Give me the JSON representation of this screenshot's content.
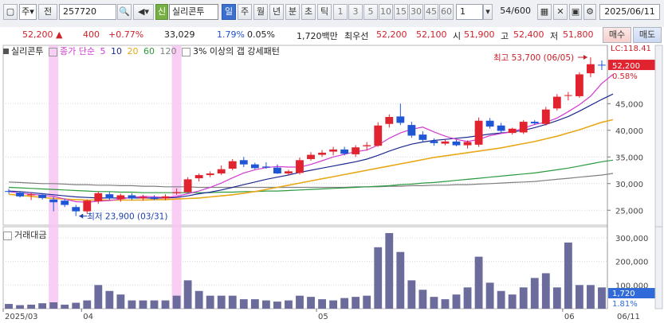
{
  "toolbar": {
    "market_sel": "주",
    "period_label": "전",
    "code": "257720",
    "badge_new": "신",
    "stock_name": "실리콘투",
    "tabs": [
      "일",
      "주",
      "월",
      "년",
      "분",
      "초",
      "틱"
    ],
    "active_tab": "일",
    "intervals": [
      "1",
      "3",
      "5",
      "10",
      "15",
      "30",
      "45",
      "60"
    ],
    "interval_input": "1",
    "count": "54",
    "count_total": "/600",
    "date": "2025/06/11"
  },
  "info": {
    "price": "52,200",
    "change": "400",
    "change_pct": "+0.77%",
    "volume": "33,029",
    "turnover_pct": "1.79%",
    "ratio": "0.05%",
    "trade_value": "1,720백만",
    "best_ask_label": "최우선",
    "best_ask": "52,200",
    "best_bid": "52,100",
    "open_label": "시",
    "open": "51,900",
    "high_label": "고",
    "high": "52,400",
    "low_label": "저",
    "low": "51,800",
    "buy_btn": "매수",
    "sell_btn": "매도"
  },
  "legend": {
    "name": "실리콘투",
    "ma_label": "종가 단순",
    "ma_periods": [
      "5",
      "10",
      "20",
      "60",
      "120"
    ],
    "gap_label": "3% 이상의 갭 강세패턴"
  },
  "price_axis": {
    "lc_label": "LC:118.41",
    "last_price": "52,200",
    "last_pct": "0.58%",
    "ticks": [
      "45,000",
      "40,000",
      "35,000",
      "30,000",
      "25,000"
    ]
  },
  "annotations": {
    "high": "최고 53,700 (06/05)",
    "low": "최저 23,900 (03/31)"
  },
  "volume_panel": {
    "label": "거래대금",
    "ticks": [
      "300,000",
      "200,000",
      "100,000"
    ],
    "last_value": "1,720",
    "last_pct": "1.81%"
  },
  "x_axis": {
    "labels": [
      "2025/03",
      "04",
      "05",
      "06",
      "06/11"
    ]
  },
  "colors": {
    "up": "#e0232e",
    "down": "#1f56d6",
    "ma5": "#d23ad1",
    "ma10": "#1d2a8f",
    "ma20": "#e8a817",
    "ma60": "#2a9a3e",
    "ma120": "#7f7f7f",
    "volume": "#6b6b9c",
    "highlight": "#f7c6f2"
  },
  "chart_data": {
    "type": "candlestick",
    "candles": [
      {
        "o": 28.6,
        "h": 29.0,
        "l": 28.1,
        "c": 28.5
      },
      {
        "o": 28.3,
        "h": 28.6,
        "l": 27.4,
        "c": 27.6
      },
      {
        "o": 27.8,
        "h": 28.3,
        "l": 26.9,
        "c": 28.0
      },
      {
        "o": 27.9,
        "h": 28.2,
        "l": 27.0,
        "c": 27.3
      },
      {
        "o": 27.0,
        "h": 27.5,
        "l": 24.8,
        "c": 26.5
      },
      {
        "o": 26.8,
        "h": 27.2,
        "l": 25.6,
        "c": 26.0
      },
      {
        "o": 25.6,
        "h": 26.0,
        "l": 23.9,
        "c": 24.8
      },
      {
        "o": 24.8,
        "h": 27.0,
        "l": 24.3,
        "c": 26.8
      },
      {
        "o": 26.7,
        "h": 28.5,
        "l": 26.2,
        "c": 28.2
      },
      {
        "o": 28.0,
        "h": 28.4,
        "l": 26.9,
        "c": 27.2
      },
      {
        "o": 27.1,
        "h": 28.1,
        "l": 26.6,
        "c": 27.8
      },
      {
        "o": 27.8,
        "h": 28.2,
        "l": 26.9,
        "c": 27.2
      },
      {
        "o": 27.2,
        "h": 27.9,
        "l": 26.8,
        "c": 27.5
      },
      {
        "o": 27.4,
        "h": 27.8,
        "l": 26.9,
        "c": 27.1
      },
      {
        "o": 27.2,
        "h": 28.0,
        "l": 26.9,
        "c": 27.6
      },
      {
        "o": 28.2,
        "h": 29.1,
        "l": 27.9,
        "c": 28.4
      },
      {
        "o": 28.4,
        "h": 31.2,
        "l": 28.3,
        "c": 30.8
      },
      {
        "o": 31.0,
        "h": 31.9,
        "l": 30.4,
        "c": 31.6
      },
      {
        "o": 31.6,
        "h": 32.3,
        "l": 31.2,
        "c": 31.9
      },
      {
        "o": 31.9,
        "h": 33.4,
        "l": 31.6,
        "c": 32.7
      },
      {
        "o": 32.8,
        "h": 34.6,
        "l": 32.5,
        "c": 34.2
      },
      {
        "o": 34.4,
        "h": 35.0,
        "l": 33.1,
        "c": 33.6
      },
      {
        "o": 33.6,
        "h": 33.9,
        "l": 32.7,
        "c": 32.9
      },
      {
        "o": 33.2,
        "h": 34.0,
        "l": 32.8,
        "c": 33.0
      },
      {
        "o": 33.0,
        "h": 33.6,
        "l": 31.8,
        "c": 31.9
      },
      {
        "o": 31.9,
        "h": 32.6,
        "l": 31.5,
        "c": 32.3
      },
      {
        "o": 32.0,
        "h": 34.9,
        "l": 31.7,
        "c": 34.4
      },
      {
        "o": 34.6,
        "h": 35.9,
        "l": 34.3,
        "c": 35.4
      },
      {
        "o": 35.4,
        "h": 36.3,
        "l": 35.0,
        "c": 35.8
      },
      {
        "o": 36.0,
        "h": 36.9,
        "l": 35.3,
        "c": 36.4
      },
      {
        "o": 36.4,
        "h": 36.9,
        "l": 35.3,
        "c": 35.6
      },
      {
        "o": 35.5,
        "h": 37.2,
        "l": 35.0,
        "c": 36.8
      },
      {
        "o": 37.0,
        "h": 37.8,
        "l": 36.2,
        "c": 37.2
      },
      {
        "o": 37.1,
        "h": 41.5,
        "l": 36.9,
        "c": 40.9
      },
      {
        "o": 41.2,
        "h": 43.0,
        "l": 40.5,
        "c": 42.5
      },
      {
        "o": 42.6,
        "h": 45.0,
        "l": 41.0,
        "c": 41.4
      },
      {
        "o": 41.0,
        "h": 41.6,
        "l": 38.6,
        "c": 39.0
      },
      {
        "o": 39.2,
        "h": 39.8,
        "l": 37.7,
        "c": 38.2
      },
      {
        "o": 38.0,
        "h": 38.5,
        "l": 37.1,
        "c": 37.6
      },
      {
        "o": 37.5,
        "h": 38.3,
        "l": 37.2,
        "c": 37.9
      },
      {
        "o": 37.9,
        "h": 38.2,
        "l": 37.0,
        "c": 37.2
      },
      {
        "o": 37.2,
        "h": 38.1,
        "l": 36.6,
        "c": 37.8
      },
      {
        "o": 37.3,
        "h": 42.4,
        "l": 36.9,
        "c": 41.8
      },
      {
        "o": 41.8,
        "h": 42.3,
        "l": 40.3,
        "c": 40.7
      },
      {
        "o": 40.9,
        "h": 41.4,
        "l": 39.6,
        "c": 39.9
      },
      {
        "o": 39.5,
        "h": 40.5,
        "l": 39.2,
        "c": 40.3
      },
      {
        "o": 39.6,
        "h": 41.9,
        "l": 39.3,
        "c": 41.6
      },
      {
        "o": 41.6,
        "h": 41.9,
        "l": 41.0,
        "c": 41.3
      },
      {
        "o": 41.2,
        "h": 44.4,
        "l": 40.9,
        "c": 43.9
      },
      {
        "o": 44.1,
        "h": 46.8,
        "l": 43.7,
        "c": 46.3
      },
      {
        "o": 46.5,
        "h": 47.2,
        "l": 45.6,
        "c": 46.6
      },
      {
        "o": 46.4,
        "h": 50.9,
        "l": 46.1,
        "c": 50.5
      },
      {
        "o": 50.7,
        "h": 53.7,
        "l": 50.0,
        "c": 52.4
      },
      {
        "o": 52.3,
        "h": 53.1,
        "l": 51.3,
        "c": 52.2
      }
    ],
    "volumes": [
      20,
      15,
      17,
      23,
      27,
      17,
      25,
      35,
      100,
      75,
      60,
      35,
      35,
      35,
      35,
      55,
      120,
      75,
      55,
      55,
      55,
      40,
      40,
      35,
      30,
      35,
      55,
      50,
      40,
      35,
      45,
      50,
      55,
      260,
      320,
      240,
      120,
      80,
      50,
      40,
      60,
      90,
      220,
      110,
      75,
      60,
      90,
      130,
      150,
      90,
      280,
      100,
      100,
      90
    ],
    "ma5": [
      28.5,
      28.2,
      28.0,
      27.8,
      27.6,
      27.1,
      26.6,
      26.5,
      26.7,
      26.8,
      27.1,
      27.4,
      27.6,
      27.5,
      27.4,
      27.6,
      28.1,
      28.6,
      29.3,
      30.1,
      31.1,
      32.0,
      32.6,
      33.0,
      33.2,
      33.1,
      33.1,
      33.6,
      34.3,
      35.0,
      35.5,
      36.0,
      36.3,
      37.2,
      38.5,
      39.5,
      40.2,
      40.6,
      39.7,
      38.9,
      38.3,
      37.9,
      38.3,
      39.0,
      39.4,
      39.7,
      40.4,
      41.1,
      41.5,
      42.3,
      43.5,
      44.8,
      46.4,
      48.8,
      50.5
    ],
    "ma10": [
      28.6,
      28.5,
      28.3,
      28.1,
      27.9,
      27.7,
      27.5,
      27.4,
      27.3,
      27.3,
      27.3,
      27.3,
      27.3,
      27.3,
      27.3,
      27.4,
      27.7,
      28.1,
      28.4,
      28.8,
      29.3,
      29.8,
      30.3,
      30.8,
      31.2,
      31.6,
      32.1,
      32.5,
      32.9,
      33.3,
      33.7,
      34.1,
      34.6,
      35.3,
      36.1,
      36.8,
      37.4,
      37.8,
      38.1,
      38.3,
      38.5,
      38.7,
      39.0,
      39.3,
      39.5,
      39.7,
      40.0,
      40.5,
      41.1,
      41.8,
      42.6,
      43.6,
      44.7,
      45.8,
      46.8
    ],
    "ma20": [
      28.0,
      27.8,
      27.6,
      27.4,
      27.2,
      27.1,
      27.0,
      26.9,
      26.9,
      26.9,
      26.9,
      26.9,
      26.9,
      27.0,
      27.0,
      27.1,
      27.2,
      27.3,
      27.5,
      27.7,
      27.9,
      28.2,
      28.5,
      28.9,
      29.3,
      29.7,
      30.1,
      30.5,
      30.9,
      31.3,
      31.7,
      32.1,
      32.5,
      32.9,
      33.3,
      33.7,
      34.1,
      34.5,
      34.9,
      35.2,
      35.5,
      35.8,
      36.1,
      36.4,
      36.7,
      37.1,
      37.5,
      37.9,
      38.4,
      38.9,
      39.5,
      40.1,
      40.8,
      41.5,
      42.0
    ],
    "ma60": [
      29.3,
      29.2,
      29.1,
      29.0,
      28.9,
      28.8,
      28.7,
      28.6,
      28.5,
      28.5,
      28.4,
      28.4,
      28.3,
      28.3,
      28.3,
      28.3,
      28.3,
      28.3,
      28.3,
      28.4,
      28.4,
      28.5,
      28.5,
      28.6,
      28.6,
      28.7,
      28.8,
      28.9,
      29.0,
      29.1,
      29.2,
      29.3,
      29.4,
      29.5,
      29.6,
      29.8,
      29.9,
      30.1,
      30.2,
      30.4,
      30.6,
      30.8,
      31.0,
      31.2,
      31.4,
      31.6,
      31.8,
      32.0,
      32.3,
      32.6,
      32.9,
      33.3,
      33.7,
      34.1,
      34.4
    ],
    "ma120": [
      30.3,
      30.2,
      30.1,
      30.0,
      30.0,
      29.9,
      29.8,
      29.8,
      29.7,
      29.7,
      29.6,
      29.6,
      29.5,
      29.5,
      29.4,
      29.4,
      29.4,
      29.3,
      29.3,
      29.3,
      29.3,
      29.3,
      29.3,
      29.3,
      29.3,
      29.3,
      29.3,
      29.3,
      29.3,
      29.3,
      29.3,
      29.4,
      29.4,
      29.4,
      29.5,
      29.5,
      29.6,
      29.6,
      29.7,
      29.7,
      29.8,
      29.8,
      29.9,
      30.0,
      30.1,
      30.2,
      30.3,
      30.4,
      30.6,
      30.8,
      31.0,
      31.2,
      31.4,
      31.6,
      31.9
    ],
    "price_ylim": [
      22.5,
      54.6
    ],
    "volume_ylim": [
      0,
      330000
    ],
    "highlight_index": [
      4,
      15
    ]
  }
}
